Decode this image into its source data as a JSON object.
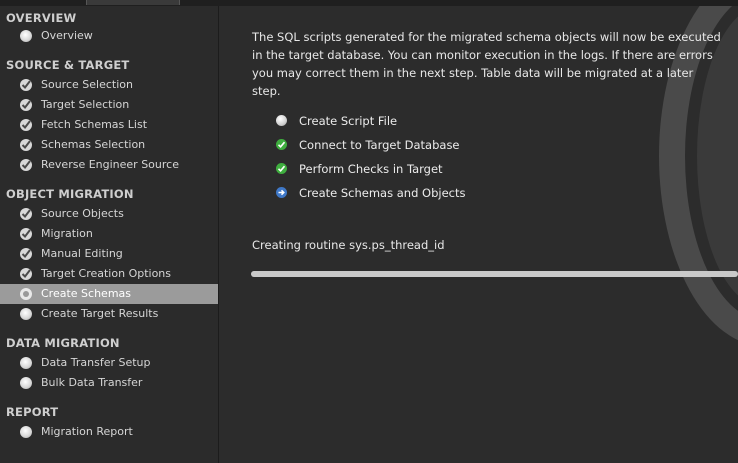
{
  "sidebar": {
    "sections": [
      {
        "title": "OVERVIEW",
        "items": [
          {
            "label": "Overview",
            "state": "pending"
          }
        ]
      },
      {
        "title": "SOURCE & TARGET",
        "items": [
          {
            "label": "Source Selection",
            "state": "done"
          },
          {
            "label": "Target Selection",
            "state": "done"
          },
          {
            "label": "Fetch Schemas List",
            "state": "done"
          },
          {
            "label": "Schemas Selection",
            "state": "done"
          },
          {
            "label": "Reverse Engineer Source",
            "state": "done"
          }
        ]
      },
      {
        "title": "OBJECT MIGRATION",
        "items": [
          {
            "label": "Source Objects",
            "state": "done"
          },
          {
            "label": "Migration",
            "state": "done"
          },
          {
            "label": "Manual Editing",
            "state": "done"
          },
          {
            "label": "Target Creation Options",
            "state": "done"
          },
          {
            "label": "Create Schemas",
            "state": "current"
          },
          {
            "label": "Create Target Results",
            "state": "pending"
          }
        ]
      },
      {
        "title": "DATA MIGRATION",
        "items": [
          {
            "label": "Data Transfer Setup",
            "state": "pending"
          },
          {
            "label": "Bulk Data Transfer",
            "state": "pending"
          }
        ]
      },
      {
        "title": "REPORT",
        "items": [
          {
            "label": "Migration Report",
            "state": "pending"
          }
        ]
      }
    ]
  },
  "main": {
    "intro": "The SQL scripts generated for the migrated schema objects will now be executed in the target database. You can monitor execution in the logs. If there are errors you may correct them in the next step. Table data will be migrated at a later step.",
    "steps": [
      {
        "label": "Create Script File",
        "status": "pending",
        "icon": "pending-dot-icon"
      },
      {
        "label": "Connect to Target Database",
        "status": "done",
        "icon": "check-icon"
      },
      {
        "label": "Perform Checks in Target",
        "status": "done",
        "icon": "check-icon"
      },
      {
        "label": "Create Schemas and Objects",
        "status": "running",
        "icon": "arrow-right-icon"
      }
    ],
    "status_text": "Creating routine sys.ps_thread_id",
    "progress": 1.0
  },
  "colors": {
    "done": "#3fae3f",
    "running": "#3f78c7",
    "selected_row": "#9b9b9b"
  }
}
